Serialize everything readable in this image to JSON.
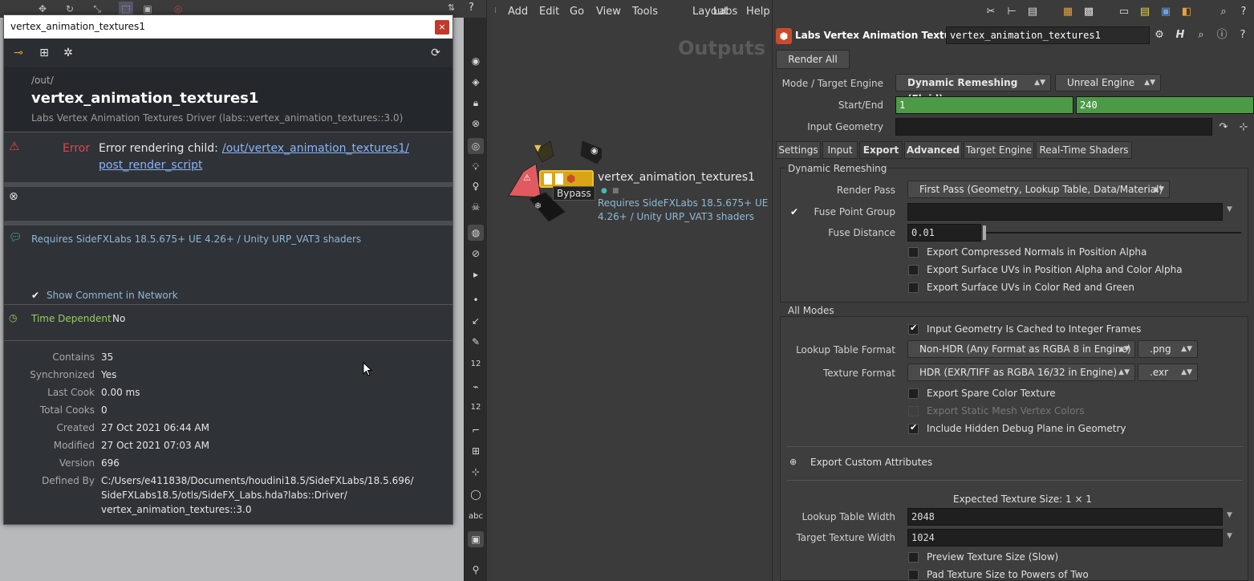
{
  "info_window": {
    "title": "vertex_animation_textures1",
    "close": "×",
    "path": "/out/",
    "node_name": "vertex_animation_textures1",
    "node_type": "Labs Vertex Animation Textures Driver (labs::vertex_animation_textures::3.0)",
    "error_label": "Error",
    "error_prefix": "Error rendering child: ",
    "error_link_1": "/out/vertex_animation_textures1/",
    "error_link_2": "post_render_script",
    "comment": "Requires SideFXLabs 18.5.675+ UE 4.26+ / Unity URP_VAT3 shaders",
    "show_comment_label": "Show Comment in Network",
    "time_dependent_label": "Time Dependent",
    "time_dependent_value": "No",
    "stats": [
      {
        "label": "Contains",
        "value": "35"
      },
      {
        "label": "Synchronized",
        "value": "Yes"
      },
      {
        "label": "Last Cook",
        "value": "0.00 ms"
      },
      {
        "label": "Total Cooks",
        "value": "0"
      },
      {
        "label": "Created",
        "value": "27 Oct 2021 06:44 AM"
      },
      {
        "label": "Modified",
        "value": "27 Oct 2021 07:03 AM"
      },
      {
        "label": "Version",
        "value": "696"
      }
    ],
    "defined_by_label": "Defined By",
    "defined_by_lines": [
      "C:/Users/e411838/Documents/houdini18.5/SideFXLabs/18.5.696/",
      "SideFXLabs18.5/otls/SideFX_Labs.hda?labs::Driver/",
      "vertex_animation_textures::3.0"
    ]
  },
  "shelf": {
    "label_12a": "12",
    "label_12b": "12",
    "label_abc": "abc"
  },
  "network": {
    "menus": [
      "Add",
      "Edit",
      "Go",
      "View",
      "Tools",
      "Layout",
      "Labs",
      "Help"
    ],
    "context_label": "Outputs",
    "node_name": "vertex_animation_textures1",
    "node_comment_line1": "Requires SideFXLabs 18.5.675+ UE",
    "node_comment_line2": "4.26+ / Unity URP_VAT3 shaders",
    "bypass_tooltip": "Bypass"
  },
  "params": {
    "node_type": "Labs Vertex Animation Textures",
    "node_name": "vertex_animation_textures1",
    "render_all": "Render All",
    "mode_label": "Mode / Target Engine",
    "mode_value": "Dynamic Remeshing (Fluid)",
    "engine_value": "Unreal Engine",
    "startend_label": "Start/End",
    "start": "1",
    "end": "240",
    "input_geo_label": "Input Geometry",
    "tabs": [
      "Settings",
      "Input",
      "Export",
      "Advanced",
      "Target Engine",
      "Real-Time Shaders"
    ],
    "dyn_group": "Dynamic Remeshing",
    "render_pass_label": "Render Pass",
    "render_pass_value": "First Pass (Geometry, Lookup Table, Data/Material)",
    "fuse_group_label": "Fuse Point Group",
    "fuse_distance_label": "Fuse Distance",
    "fuse_distance_value": "0.01",
    "dyn_checks": [
      "Export Compressed Normals in Position Alpha",
      "Export Surface UVs in Position Alpha and Color Alpha",
      "Export Surface UVs in Color Red and Green"
    ],
    "all_modes_group": "All Modes",
    "cached_label": "Input Geometry Is Cached to Integer Frames",
    "lookup_format_label": "Lookup Table Format",
    "lookup_format_value": "Non-HDR (Any Format as RGBA 8 in Engine)",
    "lookup_ext": ".png",
    "texture_format_label": "Texture Format",
    "texture_format_value": "HDR (EXR/TIFF as RGBA 16/32 in Engine)",
    "texture_ext": ".exr",
    "spare_color_label": "Export Spare Color Texture",
    "static_mesh_label": "Export Static Mesh Vertex Colors",
    "debug_plane_label": "Include Hidden Debug Plane in Geometry",
    "custom_attr_label": "Export Custom Attributes",
    "expected_size": "Expected Texture Size: 1 × 1",
    "lookup_width_label": "Lookup Table Width",
    "lookup_width_value": "2048",
    "target_width_label": "Target Texture Width",
    "target_width_value": "1024",
    "preview_label": "Preview Texture Size (Slow)",
    "pad_label": "Pad Texture Size to Powers of Two"
  },
  "colors": {
    "start_end_bg": "#4d9a46",
    "error_red": "#e0454b",
    "comment_blue": "#8fb9d6",
    "time_green": "#9ccc65"
  }
}
